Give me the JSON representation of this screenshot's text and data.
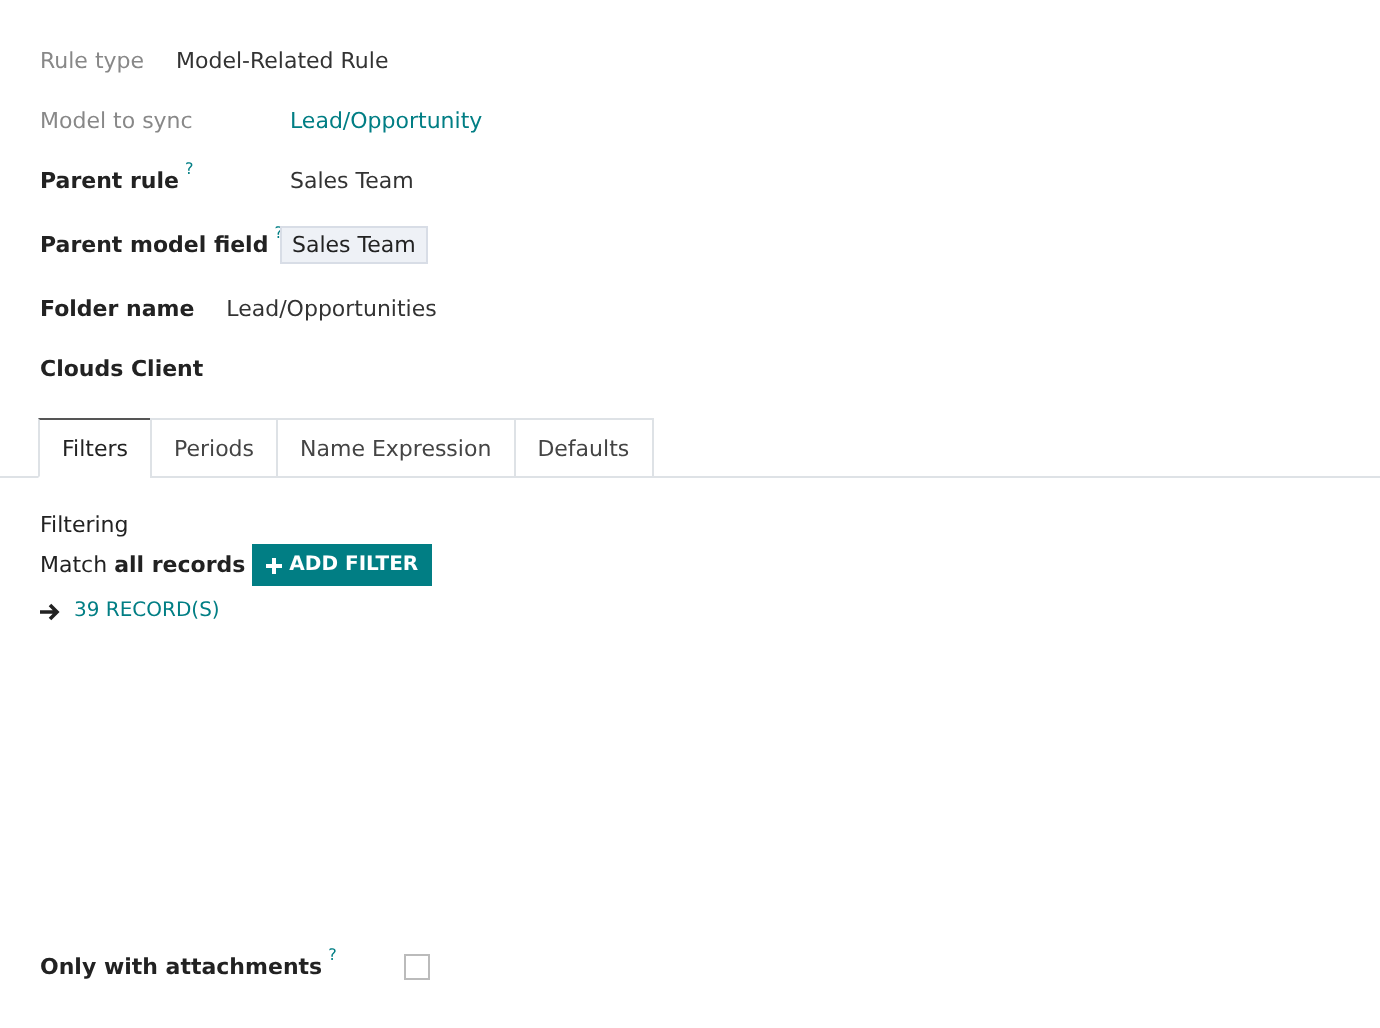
{
  "fields": [
    {
      "label": "Rule type",
      "readonly": true,
      "help": false,
      "aligned": false,
      "kind": "text",
      "value": "Model-Related Rule"
    },
    {
      "label": "Model to sync",
      "readonly": true,
      "help": false,
      "aligned": true,
      "kind": "link",
      "value": "Lead/Opportunity"
    },
    {
      "label": "Parent rule",
      "readonly": false,
      "help": true,
      "aligned": true,
      "kind": "text",
      "value": "Sales Team"
    },
    {
      "label": "Parent model field",
      "readonly": false,
      "help": true,
      "aligned": true,
      "kind": "field",
      "value": "Sales Team"
    },
    {
      "label": "Folder name",
      "readonly": false,
      "help": false,
      "aligned": false,
      "kind": "text",
      "value": "Lead/Opportunities"
    },
    {
      "label": "Clouds Client",
      "readonly": false,
      "help": false,
      "aligned": false,
      "kind": "none"
    }
  ],
  "help_mark": "?",
  "tabs": [
    {
      "label": "Filters",
      "selected": true
    },
    {
      "label": "Periods",
      "selected": false
    },
    {
      "label": "Name Expression",
      "selected": false
    },
    {
      "label": "Defaults",
      "selected": false
    }
  ],
  "filtering": {
    "title": "Filtering",
    "match": "Match **all records**",
    "add_filter": "ADD FILTER",
    "records": "39 RECORD(S)"
  },
  "attachments": {
    "label": "Only with attachments",
    "help": true,
    "checked": false
  }
}
